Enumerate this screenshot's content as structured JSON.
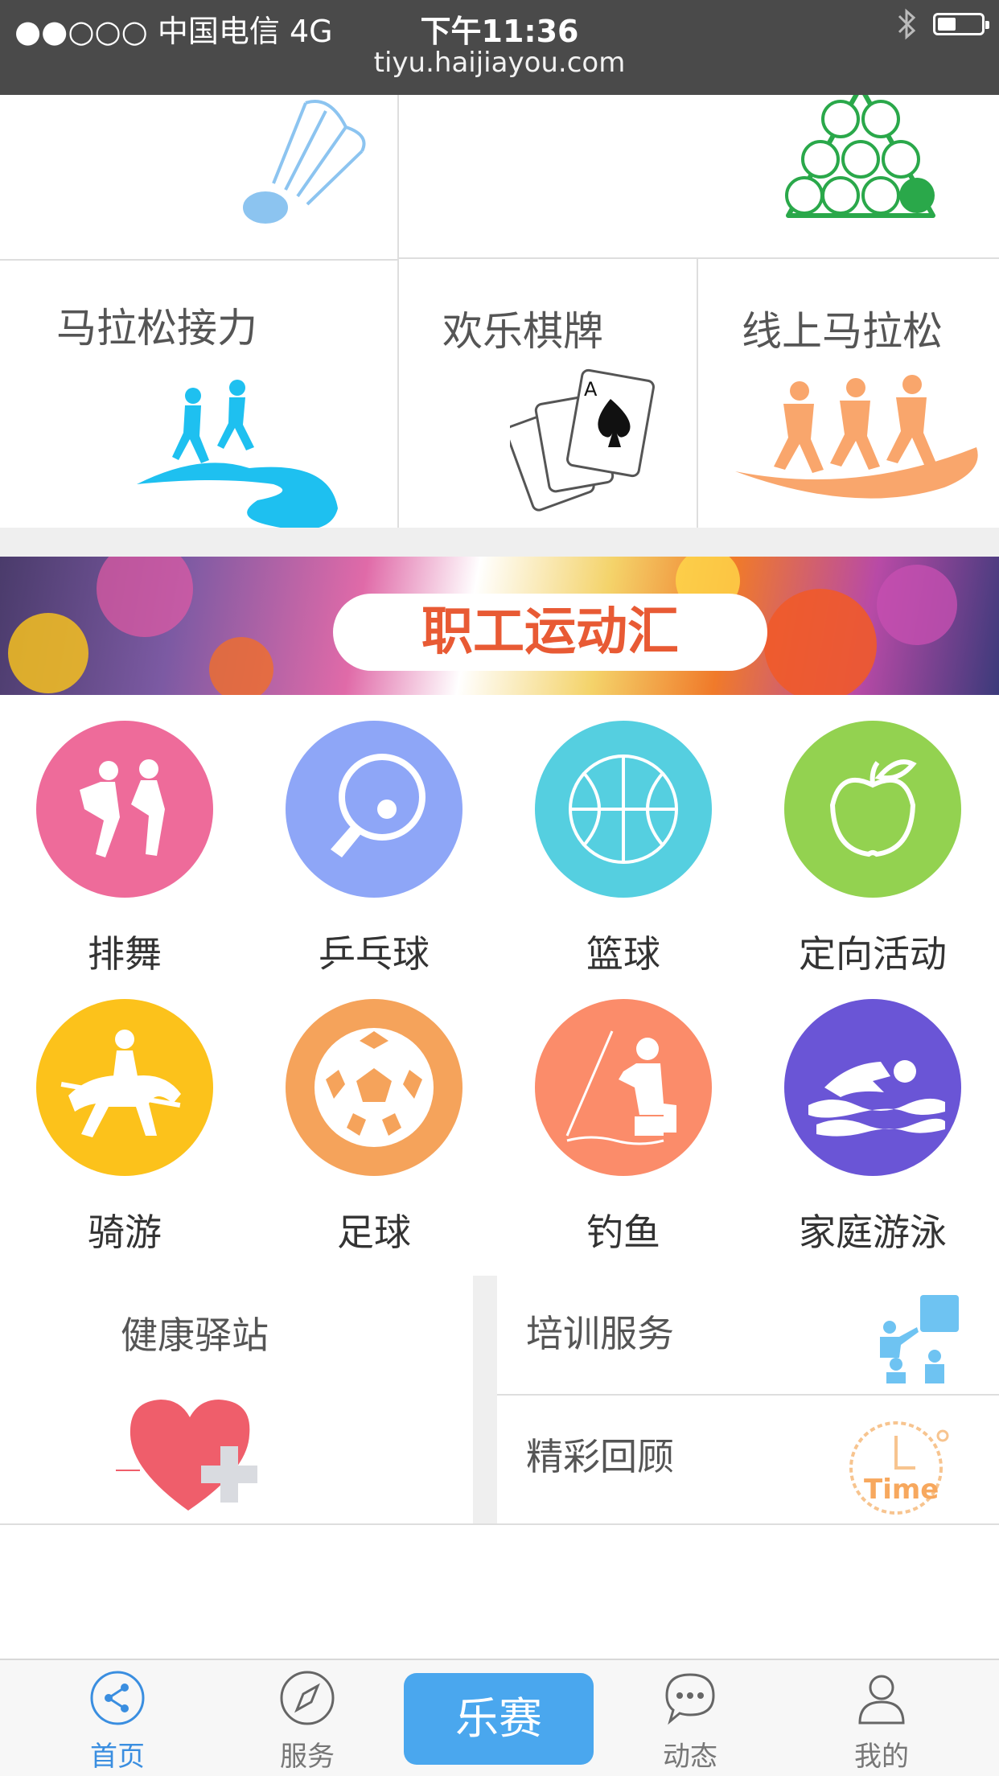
{
  "status_bar": {
    "signal_carrier": "●●○○○ 中国电信   4G",
    "time": "下午11:36",
    "url": "tiyu.haijiayou.com"
  },
  "top_grid": {
    "items": [
      {
        "label": "马拉松接力",
        "icon": "relay-runners-icon",
        "color": "#1ec0f0"
      },
      {
        "label": "欢乐棋牌",
        "icon": "playing-cards-icon",
        "color": "#222222"
      },
      {
        "label": "线上马拉松",
        "icon": "marathon-runners-icon",
        "color": "#f9a66c"
      }
    ],
    "partial_icons": [
      "badminton-shuttlecock-icon",
      "billiard-rack-icon"
    ]
  },
  "banner": {
    "title": "职工运动汇"
  },
  "sports": [
    {
      "label": "排舞",
      "icon": "dance-icon",
      "color": "#ee6b9a"
    },
    {
      "label": "乒乓球",
      "icon": "ping-pong-icon",
      "color": "#8ea6f7"
    },
    {
      "label": "篮球",
      "icon": "basketball-icon",
      "color": "#55cfe0"
    },
    {
      "label": "定向活动",
      "icon": "apple-icon",
      "color": "#93d250"
    },
    {
      "label": "骑游",
      "icon": "horse-riding-icon",
      "color": "#fcc21b"
    },
    {
      "label": "足球",
      "icon": "soccer-ball-icon",
      "color": "#f5a35b"
    },
    {
      "label": "钓鱼",
      "icon": "fishing-icon",
      "color": "#fb8c6a"
    },
    {
      "label": "家庭游泳",
      "icon": "swimming-icon",
      "color": "#6a55d6"
    }
  ],
  "panels": {
    "health": {
      "label": "健康驿站",
      "icon": "heart-plus-icon"
    },
    "training": {
      "label": "培训服务",
      "icon": "training-icon"
    },
    "review": {
      "label": "精彩回顾",
      "icon": "clock-time-icon",
      "icon_text": "Time"
    }
  },
  "tab_bar": {
    "home": "首页",
    "service": "服务",
    "center": "乐赛",
    "news": "动态",
    "mine": "我的",
    "active_color": "#3a8ee0"
  }
}
